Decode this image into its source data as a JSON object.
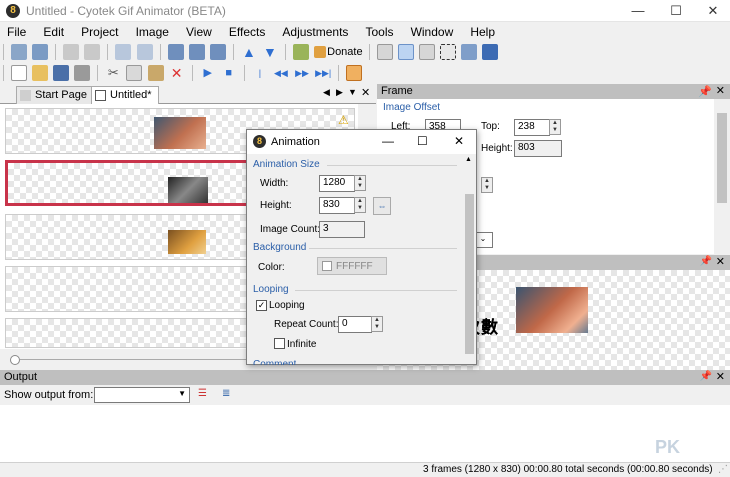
{
  "window": {
    "title": "Untitled - Cyotek Gif Animator (BETA)",
    "minimize_icon": "—",
    "maximize_icon": "☐",
    "close_icon": "✕"
  },
  "menu": [
    "File",
    "Edit",
    "Project",
    "Image",
    "View",
    "Effects",
    "Adjustments",
    "Tools",
    "Window",
    "Help"
  ],
  "toolbar": {
    "donate_label": "Donate"
  },
  "tabs": {
    "start_page": "Start Page",
    "untitled": "Untitled*"
  },
  "frame_panel": {
    "title": "Frame",
    "group_offset": "Image Offset",
    "left_label": "Left:",
    "left_value": "358",
    "top_label": "Top:",
    "top_value": "238",
    "height_label": "Height:",
    "height_value": "803"
  },
  "dialog": {
    "title": "Animation",
    "group_size": "Animation Size",
    "width_label": "Width:",
    "width_value": "1280",
    "height_label": "Height:",
    "height_value": "830",
    "image_count_label": "Image Count:",
    "image_count_value": "3",
    "group_background": "Background",
    "color_label": "Color:",
    "color_value": "FFFFFF",
    "group_looping": "Looping",
    "looping_label": "Looping",
    "looping_checked": true,
    "repeat_count_label": "Repeat Count:",
    "repeat_count_value": "0",
    "infinite_label": "Infinite",
    "infinite_checked": false,
    "group_comment": "Comment"
  },
  "annotation": "設定循環次數",
  "output": {
    "title": "Output",
    "show_from_label": "Show output from:"
  },
  "status": {
    "text": "3 frames (1280 x 830)   00:00.80 total seconds (00:00.80 seconds)"
  },
  "watermark": "PK",
  "colors": {
    "selected_frame": "#c8334a",
    "accent_blue": "#2a5ea8",
    "title_gray": "#888888"
  }
}
